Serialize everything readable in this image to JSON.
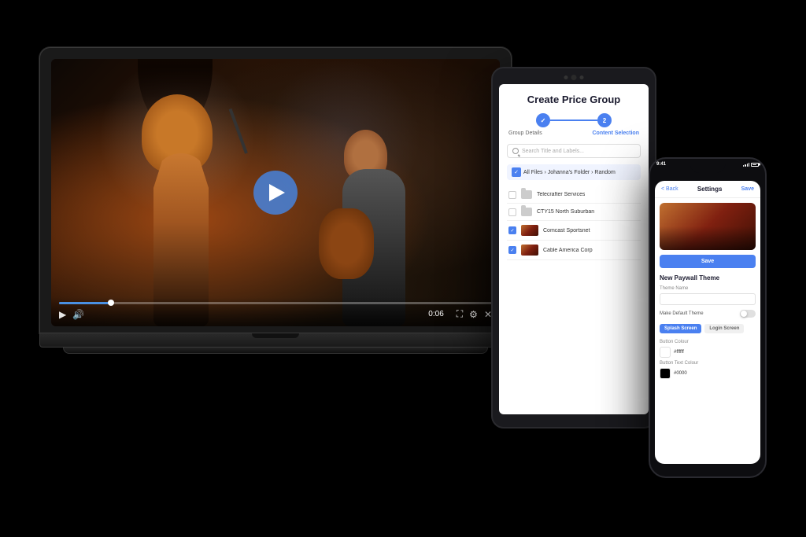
{
  "scene": {
    "background": "#000000"
  },
  "laptop": {
    "video": {
      "play_button_label": "▶",
      "time": "0:06",
      "progress_percent": 12
    }
  },
  "tablet": {
    "title": "Create Price Group",
    "steps": [
      {
        "label": "Group Details",
        "state": "done"
      },
      {
        "label": "Content Selection",
        "state": "active"
      }
    ],
    "search_placeholder": "Search Title and Labels...",
    "breadcrumb": "All Files › Johanna's Folder › Random",
    "files": [
      {
        "name": "Telecrafter Services",
        "type": "folder",
        "checked": false
      },
      {
        "name": "CTY15 North Suburban",
        "type": "folder",
        "checked": false
      },
      {
        "name": "Comcast Sportsnet",
        "type": "video",
        "checked": true
      },
      {
        "name": "Cable America Corp",
        "type": "video",
        "checked": true
      }
    ]
  },
  "phone": {
    "status_bar": {
      "time": "9:41",
      "signal": true,
      "battery": true
    },
    "header": {
      "back_label": "< Back",
      "title": "Settings",
      "save_label": "Save"
    },
    "theme_section": {
      "title": "New Paywall Theme",
      "theme_name_label": "Theme Name",
      "theme_name_value": "",
      "make_default_label": "Make Default Theme",
      "tabs": [
        "Splash Screen",
        "Login Screen"
      ],
      "button_colour_label": "Button Colour",
      "button_colour_value": "#ffffff",
      "button_text_colour_label": "Button Text Colour",
      "button_text_colour_value": "#0000"
    }
  }
}
